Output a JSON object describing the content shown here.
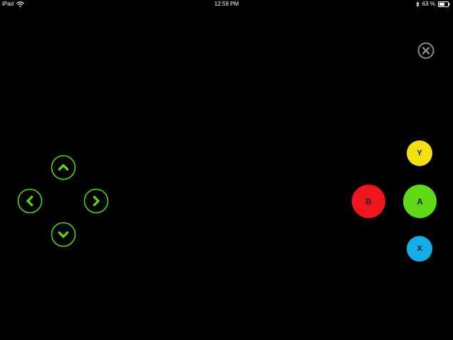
{
  "status_bar": {
    "device": "iPad",
    "time": "12:59 PM",
    "battery_percent": "63 %",
    "battery_level": 0.63
  },
  "colors": {
    "dpad": "#5fd916",
    "button_y": "#f2e010",
    "button_b": "#f0141c",
    "button_a": "#5fd916",
    "button_x": "#13aee8",
    "close": "#8a8a8a"
  },
  "controls": {
    "close_icon": "close-icon",
    "dpad": {
      "up": "chevron-up-icon",
      "down": "chevron-down-icon",
      "left": "chevron-left-icon",
      "right": "chevron-right-icon"
    },
    "face_buttons": {
      "y": "Y",
      "b": "B",
      "a": "A",
      "x": "X"
    }
  }
}
